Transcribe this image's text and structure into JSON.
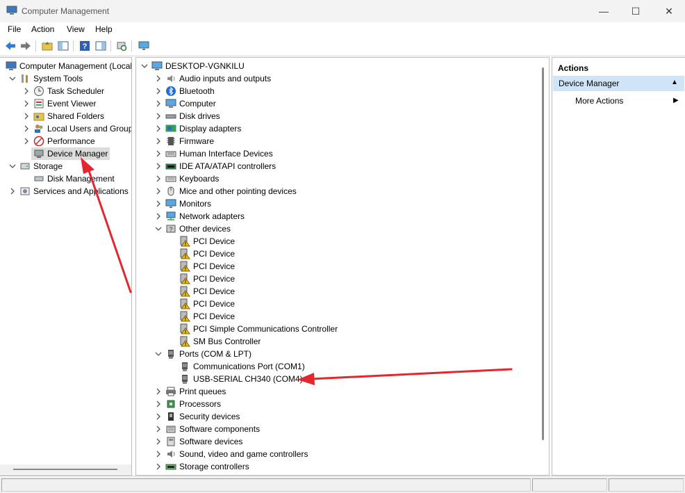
{
  "window": {
    "title": "Computer Management",
    "buttons": [
      {
        "name": "minimize-button",
        "glyph": "—"
      },
      {
        "name": "maximize-button",
        "glyph": "☐"
      },
      {
        "name": "close-button",
        "glyph": "✕"
      }
    ]
  },
  "menu": [
    "File",
    "Action",
    "View",
    "Help"
  ],
  "toolbar": {
    "buttons": [
      "back-icon",
      "forward-icon",
      "up-folder-icon",
      "show-hide-tree-icon",
      "help-icon",
      "show-hide-action-pane-icon",
      "scan-hardware-icon",
      "monitor-icon"
    ]
  },
  "left_tree": [
    {
      "label": "Computer Management (Local",
      "level": 0,
      "expander": "",
      "icon": "computer-management-icon"
    },
    {
      "label": "System Tools",
      "level": 1,
      "expander": "down",
      "icon": "system-tools-icon"
    },
    {
      "label": "Task Scheduler",
      "level": 2,
      "expander": "right",
      "icon": "clock-icon"
    },
    {
      "label": "Event Viewer",
      "level": 2,
      "expander": "right",
      "icon": "event-viewer-icon"
    },
    {
      "label": "Shared Folders",
      "level": 2,
      "expander": "right",
      "icon": "shared-folder-icon"
    },
    {
      "label": "Local Users and Groups",
      "level": 2,
      "expander": "right",
      "icon": "users-icon"
    },
    {
      "label": "Performance",
      "level": 2,
      "expander": "right",
      "icon": "performance-icon"
    },
    {
      "label": "Device Manager",
      "level": 2,
      "expander": "",
      "icon": "device-manager-icon",
      "selected": true
    },
    {
      "label": "Storage",
      "level": 1,
      "expander": "down",
      "icon": "storage-icon"
    },
    {
      "label": "Disk Management",
      "level": 2,
      "expander": "",
      "icon": "disk-icon"
    },
    {
      "label": "Services and Applications",
      "level": 1,
      "expander": "right",
      "icon": "services-icon"
    }
  ],
  "device_tree": [
    {
      "label": "DESKTOP-VGNKILU",
      "level": 0,
      "expander": "down",
      "icon": "computer-icon"
    },
    {
      "label": "Audio inputs and outputs",
      "level": 1,
      "expander": "right",
      "icon": "audio-icon"
    },
    {
      "label": "Bluetooth",
      "level": 1,
      "expander": "right",
      "icon": "bluetooth-icon"
    },
    {
      "label": "Computer",
      "level": 1,
      "expander": "right",
      "icon": "computer-icon"
    },
    {
      "label": "Disk drives",
      "level": 1,
      "expander": "right",
      "icon": "disk-drive-icon"
    },
    {
      "label": "Display adapters",
      "level": 1,
      "expander": "right",
      "icon": "display-adapter-icon"
    },
    {
      "label": "Firmware",
      "level": 1,
      "expander": "right",
      "icon": "firmware-icon"
    },
    {
      "label": "Human Interface Devices",
      "level": 1,
      "expander": "right",
      "icon": "hid-icon"
    },
    {
      "label": "IDE ATA/ATAPI controllers",
      "level": 1,
      "expander": "right",
      "icon": "ide-icon"
    },
    {
      "label": "Keyboards",
      "level": 1,
      "expander": "right",
      "icon": "keyboard-icon"
    },
    {
      "label": "Mice and other pointing devices",
      "level": 1,
      "expander": "right",
      "icon": "mouse-icon"
    },
    {
      "label": "Monitors",
      "level": 1,
      "expander": "right",
      "icon": "monitor-icon"
    },
    {
      "label": "Network adapters",
      "level": 1,
      "expander": "right",
      "icon": "network-icon"
    },
    {
      "label": "Other devices",
      "level": 1,
      "expander": "down",
      "icon": "other-devices-icon"
    },
    {
      "label": "PCI Device",
      "level": 2,
      "expander": "",
      "icon": "warning-device-icon"
    },
    {
      "label": "PCI Device",
      "level": 2,
      "expander": "",
      "icon": "warning-device-icon"
    },
    {
      "label": "PCI Device",
      "level": 2,
      "expander": "",
      "icon": "warning-device-icon"
    },
    {
      "label": "PCI Device",
      "level": 2,
      "expander": "",
      "icon": "warning-device-icon"
    },
    {
      "label": "PCI Device",
      "level": 2,
      "expander": "",
      "icon": "warning-device-icon"
    },
    {
      "label": "PCI Device",
      "level": 2,
      "expander": "",
      "icon": "warning-device-icon"
    },
    {
      "label": "PCI Device",
      "level": 2,
      "expander": "",
      "icon": "warning-device-icon"
    },
    {
      "label": "PCI Simple Communications Controller",
      "level": 2,
      "expander": "",
      "icon": "warning-device-icon"
    },
    {
      "label": "SM Bus Controller",
      "level": 2,
      "expander": "",
      "icon": "warning-device-icon"
    },
    {
      "label": "Ports (COM & LPT)",
      "level": 1,
      "expander": "down",
      "icon": "port-icon"
    },
    {
      "label": "Communications Port (COM1)",
      "level": 2,
      "expander": "",
      "icon": "port-icon"
    },
    {
      "label": "USB-SERIAL CH340 (COM4)",
      "level": 2,
      "expander": "",
      "icon": "port-icon"
    },
    {
      "label": "Print queues",
      "level": 1,
      "expander": "right",
      "icon": "printer-icon"
    },
    {
      "label": "Processors",
      "level": 1,
      "expander": "right",
      "icon": "processor-icon"
    },
    {
      "label": "Security devices",
      "level": 1,
      "expander": "right",
      "icon": "security-icon"
    },
    {
      "label": "Software components",
      "level": 1,
      "expander": "right",
      "icon": "software-component-icon"
    },
    {
      "label": "Software devices",
      "level": 1,
      "expander": "right",
      "icon": "software-device-icon"
    },
    {
      "label": "Sound, video and game controllers",
      "level": 1,
      "expander": "right",
      "icon": "sound-icon"
    },
    {
      "label": "Storage controllers",
      "level": 1,
      "expander": "right",
      "icon": "storage-controller-icon"
    }
  ],
  "actions": {
    "header": "Actions",
    "section": "Device Manager",
    "section_glyph": "▲",
    "more": "More Actions",
    "more_glyph": "▶"
  },
  "colors": {
    "annotation_arrow": "#e5262e",
    "selection": "#dcdcdc",
    "actions_section": "#cfe4f7"
  }
}
